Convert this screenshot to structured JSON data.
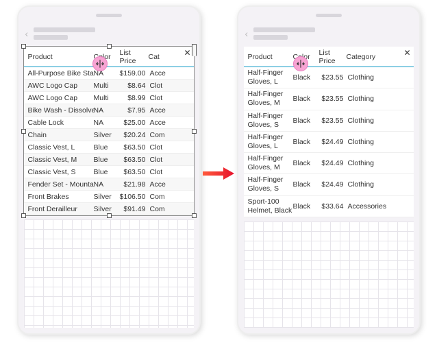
{
  "headers": {
    "product": "Product",
    "color": "Color",
    "price": "List Price",
    "category": "Category",
    "cat_trunc": "Cat"
  },
  "close": "✕",
  "phone1_rows": [
    {
      "product": "All-Purpose Bike Stand",
      "color": "NA",
      "price": "$159.00",
      "cat": "Acce"
    },
    {
      "product": "AWC Logo Cap",
      "color": "Multi",
      "price": "$8.64",
      "cat": "Clot"
    },
    {
      "product": "AWC Logo Cap",
      "color": "Multi",
      "price": "$8.99",
      "cat": "Clot"
    },
    {
      "product": "Bike Wash - Dissolver",
      "color": "NA",
      "price": "$7.95",
      "cat": "Acce"
    },
    {
      "product": "Cable Lock",
      "color": "NA",
      "price": "$25.00",
      "cat": "Acce"
    },
    {
      "product": "Chain",
      "color": "Silver",
      "price": "$20.24",
      "cat": "Com"
    },
    {
      "product": "Classic Vest, L",
      "color": "Blue",
      "price": "$63.50",
      "cat": "Clot"
    },
    {
      "product": "Classic Vest, M",
      "color": "Blue",
      "price": "$63.50",
      "cat": "Clot"
    },
    {
      "product": "Classic Vest, S",
      "color": "Blue",
      "price": "$63.50",
      "cat": "Clot"
    },
    {
      "product": "Fender Set - Mountain",
      "color": "NA",
      "price": "$21.98",
      "cat": "Acce"
    },
    {
      "product": "Front Brakes",
      "color": "Silver",
      "price": "$106.50",
      "cat": "Com"
    },
    {
      "product": "Front Derailleur",
      "color": "Silver",
      "price": "$91.49",
      "cat": "Com"
    }
  ],
  "phone2_rows": [
    {
      "product": "Half-Finger Gloves, L",
      "color": "Black",
      "price": "$23.55",
      "cat": "Clothing"
    },
    {
      "product": "Half-Finger Gloves, M",
      "color": "Black",
      "price": "$23.55",
      "cat": "Clothing"
    },
    {
      "product": "Half-Finger Gloves, S",
      "color": "Black",
      "price": "$23.55",
      "cat": "Clothing"
    },
    {
      "product": "Half-Finger Gloves, L",
      "color": "Black",
      "price": "$24.49",
      "cat": "Clothing"
    },
    {
      "product": "Half-Finger Gloves, M",
      "color": "Black",
      "price": "$24.49",
      "cat": "Clothing"
    },
    {
      "product": "Half-Finger Gloves, S",
      "color": "Black",
      "price": "$24.49",
      "cat": "Clothing"
    },
    {
      "product": "Sport-100 Helmet, Black",
      "color": "Black",
      "price": "$33.64",
      "cat": "Accessories"
    }
  ]
}
